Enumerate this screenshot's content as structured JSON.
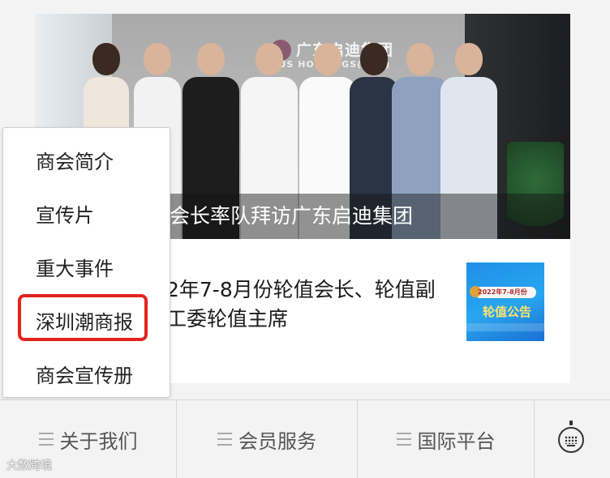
{
  "photo": {
    "caption": "副会长率队拜访广东启迪集团",
    "sign_text": "广东启迪集团",
    "sign_subtext": "TUS HOLDINGS(GBA)"
  },
  "article": {
    "title_line1": "2年7-8月份轮值会长、轮值副",
    "title_line2": "工委轮值主席",
    "thumb_badge": "2022年7-8月份",
    "thumb_title": "轮值公告"
  },
  "dropdown": {
    "items": [
      "商会简介",
      "宣传片",
      "重大事件",
      "深圳潮商报",
      "商会宣传册"
    ],
    "highlighted_item": "深圳潮商报",
    "highlight_color": "#e5231d"
  },
  "bottom_nav": {
    "tabs": [
      "关于我们",
      "会员服务",
      "国际平台"
    ],
    "keyboard_icon": "keyboard-icon"
  },
  "watermark": "大数跨境"
}
